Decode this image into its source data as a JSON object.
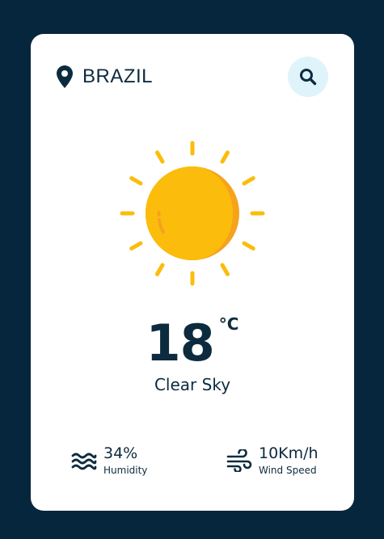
{
  "location": {
    "city": "BRAZIL",
    "icon": "location-pin-icon"
  },
  "search": {
    "icon": "search-icon"
  },
  "weather": {
    "icon": "sun-icon",
    "temperature": "18",
    "unit": "°C",
    "description": "Clear Sky"
  },
  "stats": {
    "humidity": {
      "value": "34%",
      "label": "Humidity",
      "icon": "waves-icon"
    },
    "wind": {
      "value": "10Km/h",
      "label": "Wind Speed",
      "icon": "wind-icon"
    }
  },
  "colors": {
    "background": "#06263d",
    "card": "#ffffff",
    "text": "#0d2b3e",
    "search_bg": "#dff3fb",
    "sun": "#fbbc0c",
    "sun_shade": "#f6a21d"
  }
}
